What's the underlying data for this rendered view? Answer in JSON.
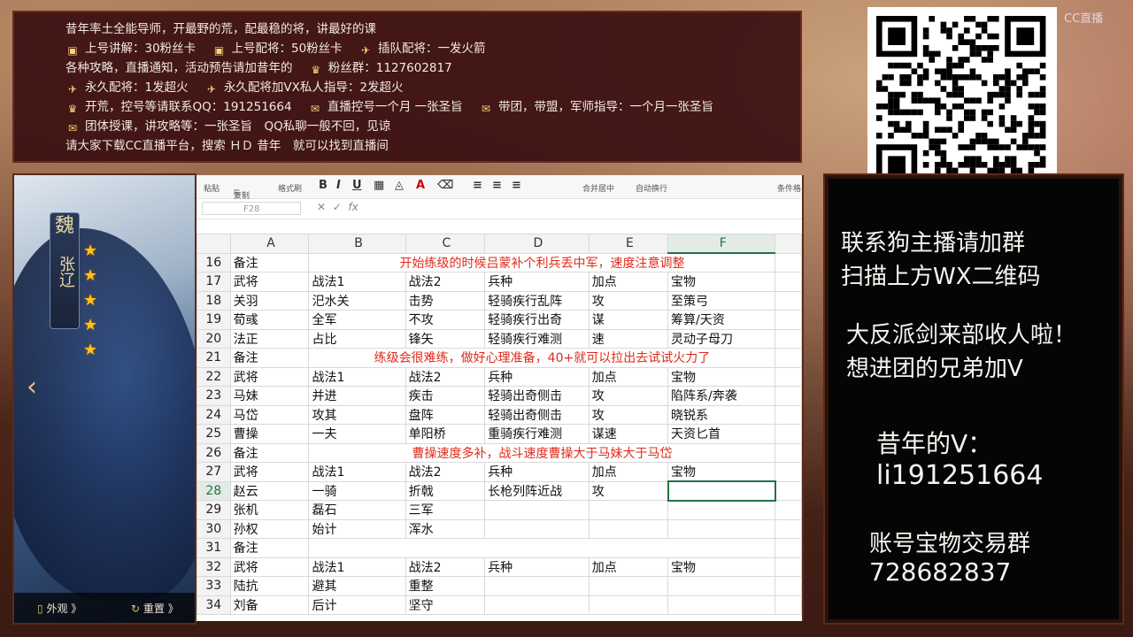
{
  "info": {
    "lines": [
      {
        "text": "昔年率土全能导师，开最野的荒，配最稳的将，讲最好的课"
      },
      {
        "segments": [
          "上号讲解：30粉丝卡",
          "上号配将：50粉丝卡",
          "插队配将：一发火箭"
        ]
      },
      {
        "segments": [
          "各种攻略，直播通知，活动预告请加昔年的",
          "粉丝群：1127602817"
        ]
      },
      {
        "segments": [
          "永久配将：1发超火",
          "永久配将加VX私人指导：2发超火"
        ]
      },
      {
        "segments": [
          "开荒，控号等请联系QQ：191251664",
          "直播控号一个月 一张圣旨",
          "带团，带盟，军师指导：一个月一张圣旨"
        ]
      },
      {
        "segments": [
          "团体授课，讲攻略等：一张圣旨　QQ私聊一般不回，见谅"
        ]
      },
      {
        "text": "请大家下载CC直播平台，搜索 ＨＤ 昔年　就可以找到直播间"
      }
    ]
  },
  "cc_logo": "CC直播",
  "right_panel": {
    "l1": "联系狗主播请加群",
    "l2": "扫描上方WX二维码",
    "l3": "大反派剑来部收人啦！",
    "l4": "想进团的兄弟加V",
    "l5": "昔年的V：",
    "l6": "li191251664",
    "l7": "账号宝物交易群",
    "l8": "728682837"
  },
  "portrait": {
    "kingdom": "魏",
    "name": "张辽",
    "stars": [
      "★",
      "★",
      "★",
      "★",
      "★"
    ],
    "btn_appearance": "外观 》",
    "btn_reset": "重置 》",
    "arrow": "‹"
  },
  "toolbar": {
    "paste": "粘贴",
    "copy": "复制",
    "format": "格式刷",
    "bold": "B",
    "italic": "I",
    "underline": "U",
    "merge": "合并居中",
    "wrap": "自动换行",
    "cond": "条件格"
  },
  "formula_bar": {
    "cell": "F28",
    "fx": "fx"
  },
  "columns": [
    "A",
    "B",
    "C",
    "D",
    "E",
    "F"
  ],
  "rows": [
    {
      "n": "16",
      "note": "开始练级的时候吕蒙补个利兵丢中军，速度注意调整",
      "A": "备注"
    },
    {
      "n": "17",
      "A": "武将",
      "B": "战法1",
      "C": "战法2",
      "D": "兵种",
      "E": "加点",
      "F": "宝物"
    },
    {
      "n": "18",
      "A": "关羽",
      "B": "汜水关",
      "C": "击势",
      "D": "轻骑疾行乱阵",
      "E": "攻",
      "F": "至策弓"
    },
    {
      "n": "19",
      "A": "荀彧",
      "B": "全军",
      "C": "不攻",
      "D": "轻骑疾行出奇",
      "E": "谋",
      "F": "筹算/天资"
    },
    {
      "n": "20",
      "A": "法正",
      "B": "占比",
      "C": "锋矢",
      "D": "轻骑疾行难测",
      "E": "速",
      "F": "灵动子母刀"
    },
    {
      "n": "21",
      "note": "练级会很难练，做好心理准备，40+就可以拉出去试试火力了",
      "A": "备注"
    },
    {
      "n": "22",
      "A": "武将",
      "B": "战法1",
      "C": "战法2",
      "D": "兵种",
      "E": "加点",
      "F": "宝物"
    },
    {
      "n": "23",
      "A": "马妹",
      "B": "并进",
      "C": "疾击",
      "D": "轻骑出奇侧击",
      "E": "攻",
      "F": "陷阵系/奔袭"
    },
    {
      "n": "24",
      "A": "马岱",
      "B": "攻其",
      "C": "盘阵",
      "D": "轻骑出奇侧击",
      "E": "攻",
      "F": "晓锐系"
    },
    {
      "n": "25",
      "A": "曹操",
      "B": "一夫",
      "C": "单阳桥",
      "D": "重骑疾行难测",
      "E": "谋速",
      "F": "天资匕首"
    },
    {
      "n": "26",
      "note": "曹操速度多补，战斗速度曹操大于马妹大于马岱",
      "A": "备注"
    },
    {
      "n": "27",
      "A": "武将",
      "B": "战法1",
      "C": "战法2",
      "D": "兵种",
      "E": "加点",
      "F": "宝物"
    },
    {
      "n": "28",
      "A": "赵云",
      "B": "一骑",
      "C": "折戟",
      "D": "长枪列阵近战",
      "E": "攻",
      "F": ""
    },
    {
      "n": "29",
      "A": "张机",
      "B": "磊石",
      "C": "三军",
      "D": "",
      "E": "",
      "F": ""
    },
    {
      "n": "30",
      "A": "孙权",
      "B": "始计",
      "C": "浑水",
      "D": "",
      "E": "",
      "F": ""
    },
    {
      "n": "31",
      "A": "备注",
      "note": ""
    },
    {
      "n": "32",
      "A": "武将",
      "B": "战法1",
      "C": "战法2",
      "D": "兵种",
      "E": "加点",
      "F": "宝物"
    },
    {
      "n": "33",
      "A": "陆抗",
      "B": "避其",
      "C": "重整",
      "D": "",
      "E": "",
      "F": ""
    },
    {
      "n": "34",
      "A": "刘备",
      "B": "后计",
      "C": "坚守",
      "D": "",
      "E": "",
      "F": ""
    }
  ],
  "selected_row": "28",
  "selected_col": "F",
  "colors": {
    "note": "#e02a1b",
    "select": "#217346"
  }
}
